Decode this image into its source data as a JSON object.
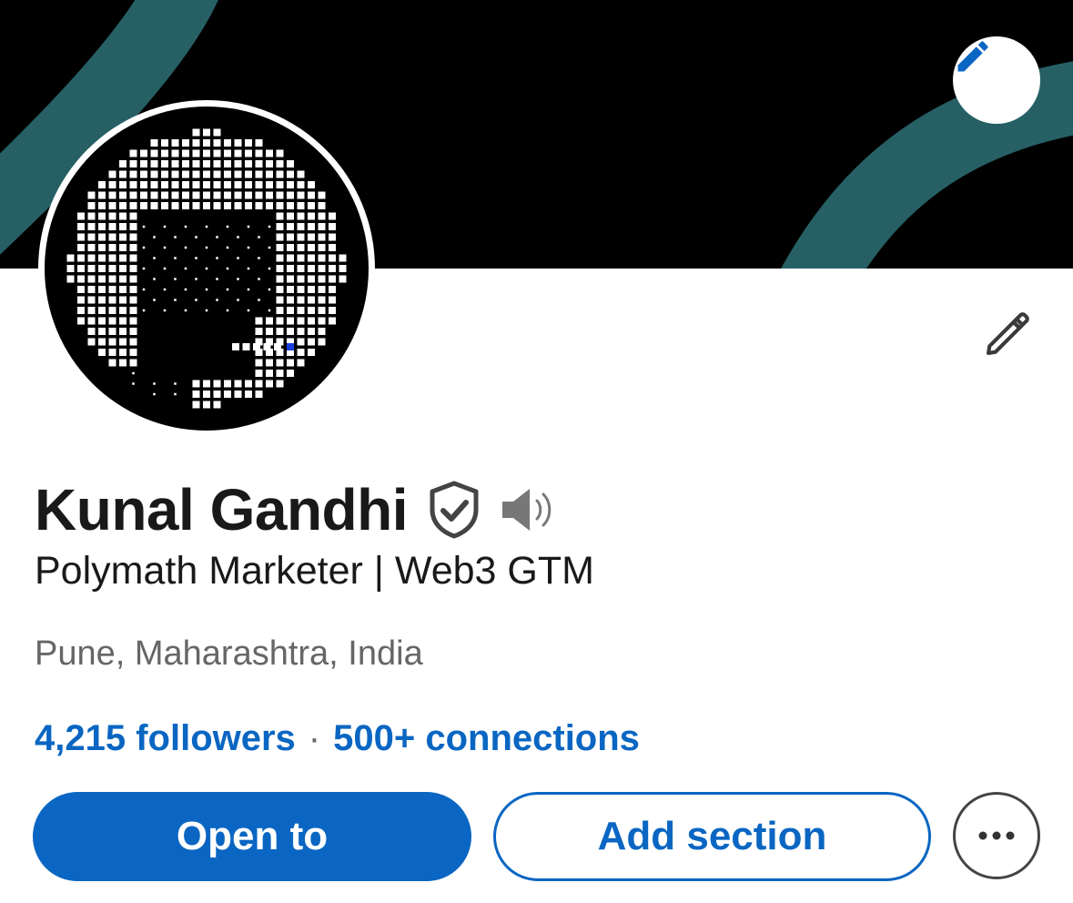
{
  "profile": {
    "name": "Kunal Gandhi",
    "headline": "Polymath Marketer | Web3 GTM",
    "location": "Pune, Maharashtra, India",
    "followers": "4,215 followers",
    "separator": "·",
    "connections": "500+ connections"
  },
  "icons": {
    "banner_edit": "pencil-icon",
    "intro_edit": "pencil-outline-icon",
    "verified": "shield-check-icon",
    "pronunciation": "speaker-icon",
    "more": "ellipsis-icon"
  },
  "actions": {
    "open_to_label": "Open to",
    "add_section_label": "Add section"
  },
  "colors": {
    "brand_blue": "#0a66c2",
    "banner_background": "#000000",
    "banner_arc": "#2a6a70",
    "text_primary": "#191919",
    "text_secondary": "#666666"
  }
}
